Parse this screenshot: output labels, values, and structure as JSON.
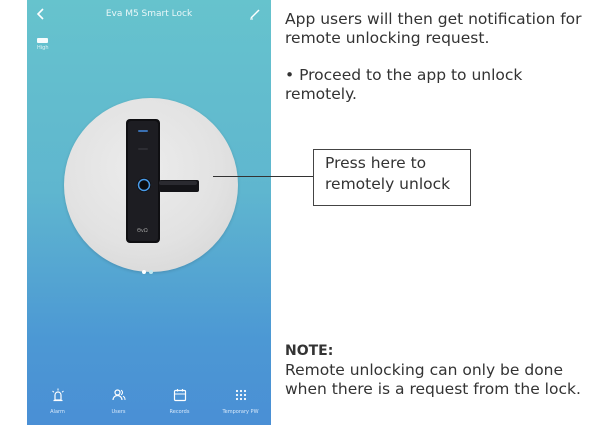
{
  "app": {
    "title": "Eva M5 Smart Lock",
    "battery_label": "High",
    "lock_brand": "ΘvΩ",
    "pager": {
      "count": 2,
      "active_index": 0
    }
  },
  "bottom_nav": [
    {
      "label": "Alarm",
      "icon": "alarm-icon"
    },
    {
      "label": "Users",
      "icon": "users-icon"
    },
    {
      "label": "Records",
      "icon": "records-icon"
    },
    {
      "label": "Temporary PW",
      "icon": "keypad-icon"
    }
  ],
  "instructions": {
    "para1": "App users will then get notification for remote unlocking request.",
    "para2": "• Proceed to the app to unlock remotely."
  },
  "callout": {
    "line1": "Press here to",
    "line2": "remotely unlock"
  },
  "note": {
    "heading": "NOTE:",
    "text": "Remote unlocking can only be done when there is a request from the lock."
  },
  "colors": {
    "gradient_top": "#66c3cd",
    "gradient_bottom": "#4a8fd5",
    "lock_body": "#1a1a1e",
    "lock_accent": "#3a8fe0"
  }
}
